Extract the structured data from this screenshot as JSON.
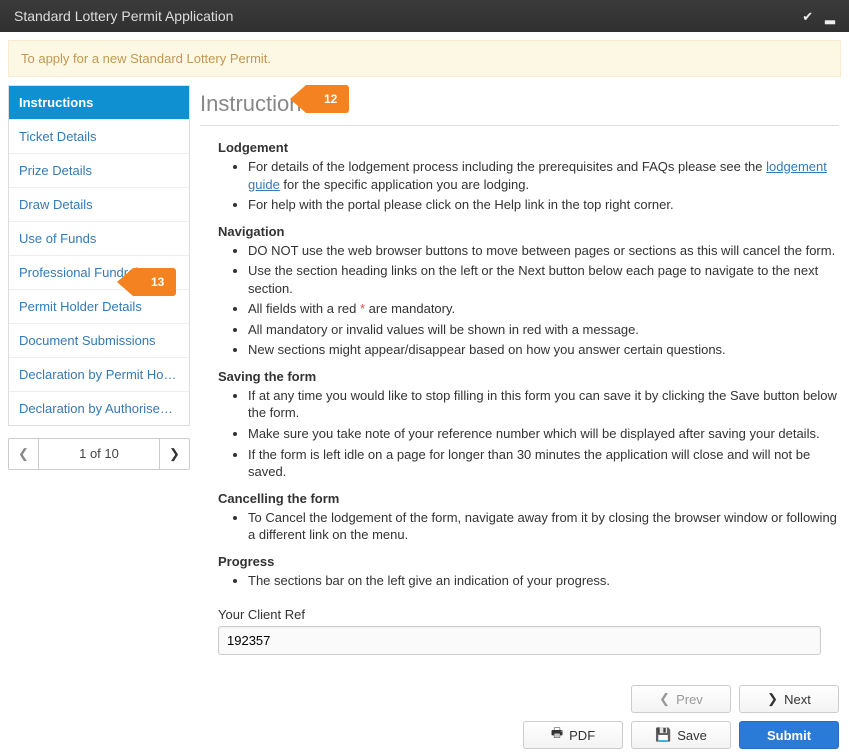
{
  "topbar": {
    "title": "Standard Lottery Permit Application"
  },
  "banner": {
    "text": "To apply for a new Standard Lottery Permit."
  },
  "sidebar": {
    "items": [
      {
        "label": "Instructions",
        "active": true
      },
      {
        "label": "Ticket Details"
      },
      {
        "label": "Prize Details"
      },
      {
        "label": "Draw Details"
      },
      {
        "label": "Use of Funds"
      },
      {
        "label": "Professional Fundraiser D…"
      },
      {
        "label": "Permit Holder Details"
      },
      {
        "label": "Document Submissions"
      },
      {
        "label": "Declaration by Permit Holder"
      },
      {
        "label": "Declaration by Authorised…"
      }
    ],
    "pager": {
      "label": "1 of 10"
    }
  },
  "page": {
    "title": "Instructions",
    "sections": {
      "lodgement": {
        "heading": "Lodgement",
        "li1a": "For details of the lodgement process including the prerequisites and FAQs please see the ",
        "li1link": "lodgement guide",
        "li1b": " for the specific application you are lodging.",
        "li2": "For help with the portal please click on the Help link in the top right corner."
      },
      "navigation": {
        "heading": "Navigation",
        "li1": "DO NOT use the web browser buttons to move between pages or sections as this will cancel the form.",
        "li2": "Use the section heading links on the left or the Next button below each page to navigate to the next section.",
        "li3a": "All fields with a red ",
        "li3star": "*",
        "li3b": " are mandatory.",
        "li4": "All mandatory or invalid values will be shown in red with a message.",
        "li5": "New sections might appear/disappear based on how you answer certain questions."
      },
      "saving": {
        "heading": "Saving the form",
        "li1": "If at any time you would like to stop filling in this form you can save it by clicking the Save button below the form.",
        "li2": "Make sure you take note of your reference number which will be displayed after saving your details.",
        "li3": "If the form is left idle on a page for longer than 30 minutes the application will close and will not be saved."
      },
      "cancelling": {
        "heading": "Cancelling the form",
        "li1": "To Cancel the lodgement of the form, navigate away from it by closing the browser window or following a different link on the menu."
      },
      "progress": {
        "heading": "Progress",
        "li1": "The sections bar on the left give an indication of your progress."
      }
    },
    "clientRef": {
      "label": "Your Client Ref",
      "value": "192357"
    }
  },
  "footer": {
    "prev": "Prev",
    "next": "Next",
    "pdf": "PDF",
    "save": "Save",
    "submit": "Submit"
  },
  "callouts": {
    "c12": "12",
    "c13": "13"
  }
}
